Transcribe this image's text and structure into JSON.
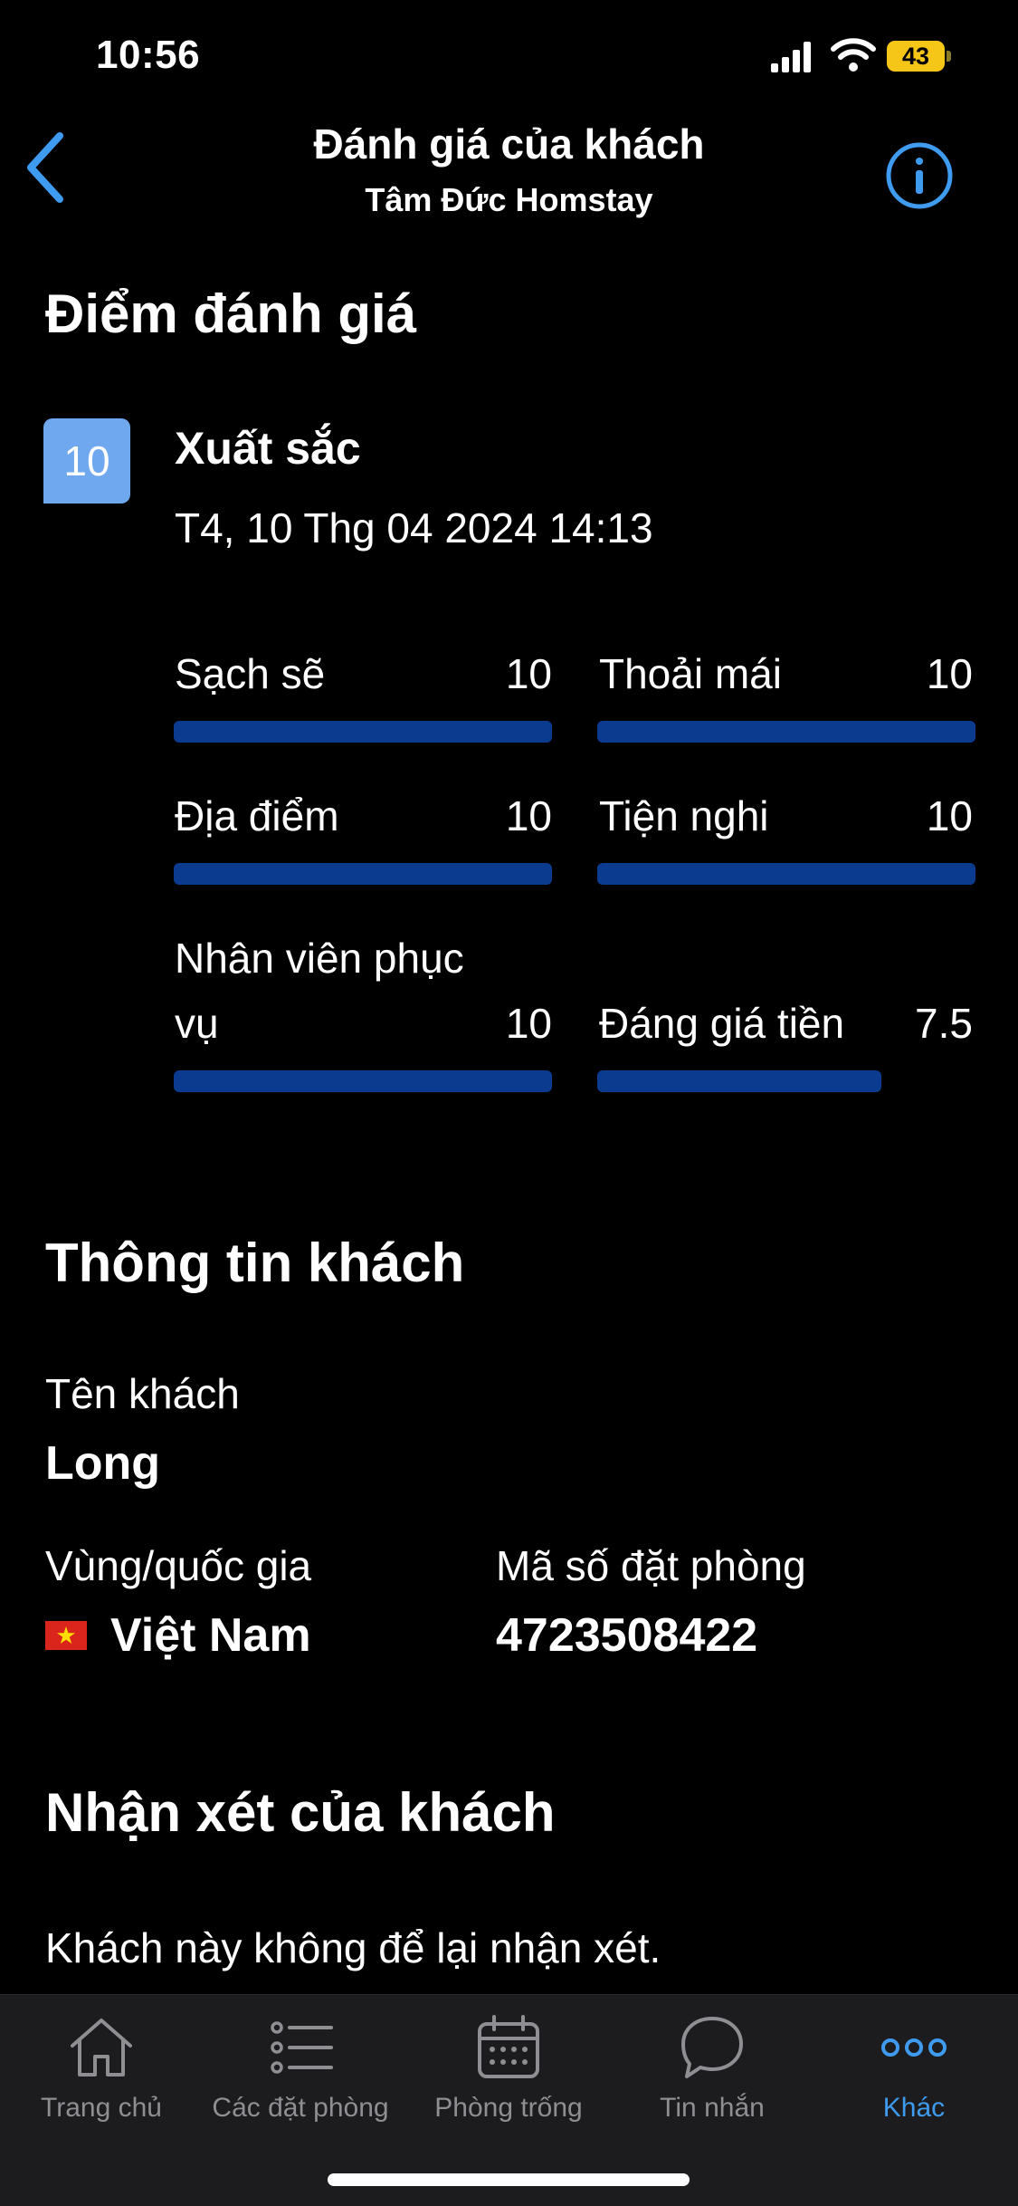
{
  "status": {
    "time": "10:56",
    "battery": "43"
  },
  "header": {
    "title": "Đánh giá của khách",
    "subtitle": "Tâm Đức Homstay"
  },
  "rating_section": {
    "heading": "Điểm đánh giá",
    "score": "10",
    "score_word": "Xuất sắc",
    "date": "T4, 10 Thg 04 2024 14:13",
    "categories": [
      {
        "label": "Sạch sẽ",
        "value": "10",
        "fraction": 1.0
      },
      {
        "label": "Thoải mái",
        "value": "10",
        "fraction": 1.0
      },
      {
        "label": "Địa điểm",
        "value": "10",
        "fraction": 1.0
      },
      {
        "label": "Tiện nghi",
        "value": "10",
        "fraction": 1.0
      },
      {
        "label_line1": "Nhân viên phục",
        "label_line2": "vụ",
        "value": "10",
        "fraction": 1.0
      },
      {
        "label": "Đáng giá tiền",
        "value": "7.5",
        "fraction": 0.75
      }
    ]
  },
  "guest_info": {
    "heading": "Thông tin khách",
    "name_label": "Tên khách",
    "name": "Long",
    "country_label": "Vùng/quốc gia",
    "country": "Việt Nam",
    "booking_label": "Mã số đặt phòng",
    "booking_number": "4723508422"
  },
  "review": {
    "heading": "Nhận xét của khách",
    "text": "Khách này không để lại nhận xét."
  },
  "tabs": [
    {
      "label": "Trang chủ",
      "icon": "home-icon"
    },
    {
      "label": "Các đặt phòng",
      "icon": "list-icon"
    },
    {
      "label": "Phòng trống",
      "icon": "calendar-icon"
    },
    {
      "label": "Tin nhắn",
      "icon": "chat-icon"
    },
    {
      "label": "Khác",
      "icon": "more-icon",
      "active": true
    }
  ],
  "colors": {
    "accent": "#3f9bef",
    "bar": "#0b3b8e",
    "badge": "#6fa8ef"
  }
}
